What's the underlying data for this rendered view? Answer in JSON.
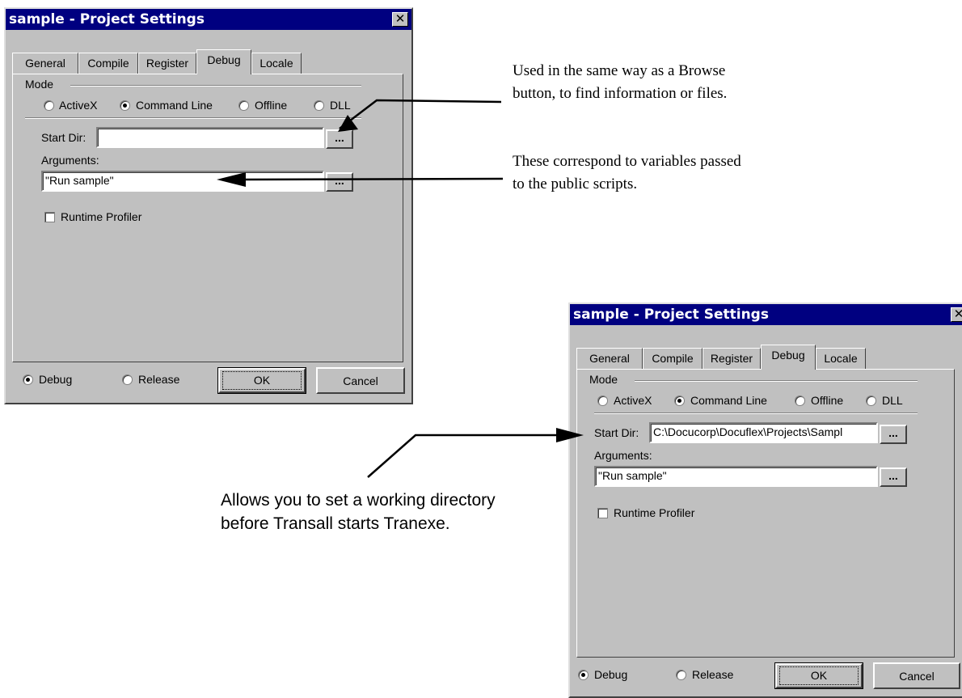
{
  "dialog1": {
    "title": "sample - Project Settings",
    "close": "✕",
    "tabs": [
      "General",
      "Compile",
      "Register",
      "Debug",
      "Locale"
    ],
    "active_tab": "Debug",
    "mode_label": "Mode",
    "modes": [
      "ActiveX",
      "Command Line",
      "Offline",
      "DLL"
    ],
    "selected_mode": "Command Line",
    "start_dir_label": "Start Dir:",
    "start_dir_value": "",
    "arguments_label": "Arguments:",
    "arguments_value": "\"Run sample\"",
    "browse_label": "...",
    "runtime_profiler": "Runtime Profiler",
    "build_debug": "Debug",
    "build_release": "Release",
    "ok": "OK",
    "cancel": "Cancel"
  },
  "dialog2": {
    "title": "sample - Project Settings",
    "close": "✕",
    "tabs": [
      "General",
      "Compile",
      "Register",
      "Debug",
      "Locale"
    ],
    "active_tab": "Debug",
    "mode_label": "Mode",
    "modes": [
      "ActiveX",
      "Command Line",
      "Offline",
      "DLL"
    ],
    "selected_mode": "Command Line",
    "start_dir_label": "Start Dir:",
    "start_dir_value": "C:\\Docucorp\\Docuflex\\Projects\\Sampl",
    "arguments_label": "Arguments:",
    "arguments_value": "\"Run sample\"",
    "browse_label": "...",
    "runtime_profiler": "Runtime Profiler",
    "build_debug": "Debug",
    "build_release": "Release",
    "ok": "OK",
    "cancel": "Cancel"
  },
  "callouts": {
    "browse": [
      "Used in the same way as a Browse",
      "button, to find information or files."
    ],
    "arguments": [
      "These correspond to variables passed",
      "to the public scripts."
    ],
    "startdir": [
      "Allows you to set a working directory",
      "before Transall starts Tranexe."
    ]
  }
}
